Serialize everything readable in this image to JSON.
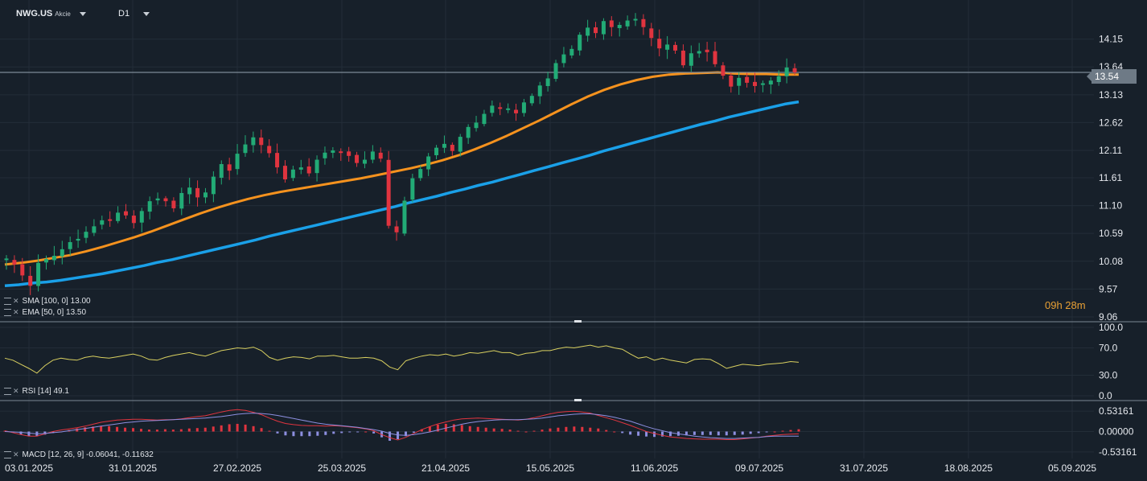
{
  "header": {
    "symbol": "NWG.US",
    "instrument_type": "Akcie",
    "timeframe": "D1"
  },
  "price_tag": "13.54",
  "timer": "09h 28m",
  "legends": {
    "sma": "SMA [100, 0] 13.00",
    "ema": "EMA [50, 0] 13.50",
    "rsi": "RSI [14] 49.1",
    "macd": "MACD [12, 26, 9] -0.06041, -0.11632"
  },
  "colors": {
    "background": "#17202a",
    "grid": "#232d38",
    "up_candle": "#22ab76",
    "down_candle": "#e0343f",
    "ema": "#f5921e",
    "sma": "#1aa0e8",
    "rsi": "#d9d060",
    "macd_line": "#e0343f",
    "signal_line": "#8d8fe0",
    "hist_pos": "#e0343f",
    "hist_neg": "#8d8fe0",
    "price_line": "#7d8a96"
  },
  "chart_data": [
    {
      "type": "candlestick",
      "yticks": [
        "14.15",
        "13.64",
        "13.13",
        "12.62",
        "12.11",
        "11.61",
        "11.10",
        "10.59",
        "10.08",
        "9.57",
        "9.06"
      ],
      "ylim": [
        9.06,
        14.66
      ],
      "x_date_labels": [
        "03.01.2025",
        "31.01.2025",
        "27.02.2025",
        "25.03.2025",
        "21.04.2025",
        "15.05.2025",
        "11.06.2025",
        "09.07.2025",
        "31.07.2025",
        "18.08.2025",
        "05.09.2025"
      ],
      "last_price": 13.54,
      "close": [
        10.13,
        10.02,
        9.82,
        9.63,
        10.05,
        10.12,
        10.18,
        10.3,
        10.43,
        10.49,
        10.62,
        10.72,
        10.83,
        10.82,
        10.97,
        10.92,
        10.78,
        11.0,
        11.18,
        11.23,
        11.18,
        11.05,
        11.33,
        11.43,
        11.25,
        11.34,
        11.63,
        11.86,
        11.74,
        12.05,
        12.22,
        12.35,
        12.21,
        12.06,
        11.8,
        11.58,
        11.76,
        11.8,
        11.69,
        11.94,
        12.07,
        12.11,
        12.08,
        12.01,
        11.88,
        11.94,
        12.09,
        11.96,
        10.73,
        10.61,
        11.19,
        11.6,
        11.77,
        12.0,
        12.16,
        12.23,
        12.1,
        12.36,
        12.54,
        12.62,
        12.78,
        12.93,
        12.88,
        12.88,
        12.79,
        12.99,
        13.11,
        13.3,
        13.43,
        13.71,
        13.87,
        13.97,
        14.23,
        14.36,
        14.26,
        14.48,
        14.37,
        14.41,
        14.49,
        14.52,
        14.37,
        14.17,
        13.98,
        14.05,
        13.94,
        13.67,
        13.89,
        13.93,
        13.91,
        13.69,
        13.48,
        13.28,
        13.44,
        13.35,
        13.29,
        13.34,
        13.39,
        13.47,
        13.63,
        13.54
      ],
      "sma": [
        9.63,
        9.65,
        9.68,
        9.7,
        9.73,
        9.77,
        9.81,
        9.85,
        9.9,
        9.95,
        10.0,
        10.06,
        10.11,
        10.17,
        10.23,
        10.29,
        10.35,
        10.41,
        10.47,
        10.54,
        10.6,
        10.66,
        10.72,
        10.78,
        10.84,
        10.9,
        10.96,
        11.02,
        11.08,
        11.15,
        11.21,
        11.27,
        11.34,
        11.4,
        11.47,
        11.53,
        11.6,
        11.67,
        11.74,
        11.81,
        11.88,
        11.95,
        12.02,
        12.1,
        12.17,
        12.24,
        12.31,
        12.38,
        12.45,
        12.52,
        12.59,
        12.65,
        12.72,
        12.78,
        12.84,
        12.9,
        12.96,
        13.0
      ],
      "ema": [
        10.02,
        10.05,
        10.09,
        10.14,
        10.19,
        10.26,
        10.34,
        10.43,
        10.52,
        10.62,
        10.73,
        10.84,
        10.95,
        11.05,
        11.14,
        11.22,
        11.29,
        11.35,
        11.4,
        11.45,
        11.5,
        11.55,
        11.6,
        11.66,
        11.72,
        11.78,
        11.85,
        11.93,
        12.02,
        12.13,
        12.25,
        12.38,
        12.52,
        12.66,
        12.81,
        12.96,
        13.1,
        13.22,
        13.32,
        13.4,
        13.46,
        13.5,
        13.52,
        13.53,
        13.54,
        13.52,
        13.51,
        13.51,
        13.5,
        13.5
      ]
    },
    {
      "type": "line",
      "name": "RSI [14]",
      "yticks": [
        "100.0",
        "70.0",
        "30.0",
        "0.0"
      ],
      "ylim": [
        0,
        100
      ],
      "values": [
        55,
        52,
        46,
        40,
        33,
        44,
        52,
        55,
        53,
        52,
        56,
        58,
        56,
        55,
        57,
        59,
        61,
        58,
        53,
        52,
        56,
        59,
        61,
        63,
        60,
        58,
        62,
        66,
        68,
        70,
        69,
        71,
        66,
        56,
        52,
        55,
        57,
        56,
        54,
        58,
        58,
        59,
        57,
        55,
        55,
        56,
        55,
        51,
        42,
        38,
        51,
        55,
        58,
        60,
        59,
        61,
        58,
        60,
        63,
        62,
        64,
        66,
        63,
        63,
        59,
        62,
        63,
        66,
        66,
        69,
        71,
        70,
        72,
        74,
        71,
        73,
        70,
        68,
        61,
        55,
        57,
        52,
        55,
        52,
        50,
        48,
        53,
        54,
        53,
        47,
        40,
        43,
        46,
        45,
        44,
        46,
        47,
        48,
        50,
        49
      ]
    },
    {
      "type": "bar+line",
      "name": "MACD [12, 26, 9]",
      "yticks": [
        "0.53161",
        "0.00000",
        "-0.53161"
      ],
      "ylim": [
        -0.66,
        0.66
      ],
      "histogram": [
        0.02,
        -0.03,
        -0.08,
        -0.12,
        -0.12,
        -0.08,
        -0.04,
        0.0,
        0.04,
        0.08,
        0.11,
        0.13,
        0.14,
        0.14,
        0.12,
        0.1,
        0.09,
        0.07,
        0.05,
        0.05,
        0.06,
        0.05,
        0.06,
        0.08,
        0.09,
        0.1,
        0.13,
        0.16,
        0.19,
        0.2,
        0.18,
        0.14,
        0.09,
        0.02,
        -0.05,
        -0.1,
        -0.12,
        -0.12,
        -0.12,
        -0.11,
        -0.09,
        -0.06,
        -0.04,
        -0.02,
        -0.01,
        0.0,
        -0.05,
        -0.15,
        -0.24,
        -0.2,
        -0.12,
        -0.03,
        0.06,
        0.13,
        0.18,
        0.2,
        0.19,
        0.17,
        0.14,
        0.12,
        0.1,
        0.08,
        0.07,
        0.05,
        0.02,
        0.0,
        0.02,
        0.05,
        0.08,
        0.1,
        0.12,
        0.13,
        0.12,
        0.1,
        0.08,
        0.04,
        0.0,
        -0.04,
        -0.08,
        -0.11,
        -0.13,
        -0.14,
        -0.13,
        -0.12,
        -0.11,
        -0.1,
        -0.09,
        -0.09,
        -0.09,
        -0.1,
        -0.1,
        -0.09,
        -0.08,
        -0.06,
        -0.04,
        -0.02,
        0.0,
        0.02,
        0.04,
        0.06
      ],
      "macd": [
        0.02,
        -0.03,
        -0.08,
        -0.12,
        -0.12,
        -0.06,
        0.0,
        0.04,
        0.07,
        0.1,
        0.14,
        0.19,
        0.24,
        0.27,
        0.3,
        0.31,
        0.32,
        0.32,
        0.31,
        0.3,
        0.31,
        0.31,
        0.33,
        0.36,
        0.39,
        0.41,
        0.46,
        0.51,
        0.55,
        0.57,
        0.55,
        0.5,
        0.44,
        0.35,
        0.27,
        0.21,
        0.18,
        0.16,
        0.15,
        0.15,
        0.14,
        0.15,
        0.14,
        0.12,
        0.1,
        0.07,
        0.02,
        -0.08,
        -0.16,
        -0.22,
        -0.15,
        -0.05,
        0.05,
        0.13,
        0.2,
        0.25,
        0.3,
        0.33,
        0.34,
        0.35,
        0.34,
        0.33,
        0.32,
        0.31,
        0.3,
        0.32,
        0.36,
        0.41,
        0.46,
        0.5,
        0.52,
        0.53,
        0.51,
        0.48,
        0.42,
        0.36,
        0.3,
        0.23,
        0.16,
        0.08,
        0.0,
        -0.05,
        -0.1,
        -0.14,
        -0.16,
        -0.18,
        -0.19,
        -0.2,
        -0.2,
        -0.2,
        -0.21,
        -0.21,
        -0.19,
        -0.17,
        -0.15,
        -0.12,
        -0.1,
        -0.08,
        -0.07,
        -0.06
      ],
      "signal": [
        0.0,
        -0.01,
        -0.02,
        -0.04,
        -0.06,
        -0.05,
        -0.03,
        -0.01,
        0.02,
        0.05,
        0.08,
        0.11,
        0.14,
        0.17,
        0.2,
        0.23,
        0.25,
        0.27,
        0.28,
        0.29,
        0.3,
        0.31,
        0.32,
        0.33,
        0.34,
        0.35,
        0.37,
        0.39,
        0.42,
        0.45,
        0.47,
        0.48,
        0.47,
        0.45,
        0.42,
        0.38,
        0.34,
        0.3,
        0.26,
        0.22,
        0.19,
        0.17,
        0.15,
        0.13,
        0.11,
        0.08,
        0.05,
        0.01,
        -0.05,
        -0.09,
        -0.1,
        -0.08,
        -0.05,
        -0.01,
        0.04,
        0.09,
        0.14,
        0.19,
        0.23,
        0.26,
        0.28,
        0.3,
        0.31,
        0.31,
        0.31,
        0.32,
        0.33,
        0.35,
        0.38,
        0.41,
        0.43,
        0.45,
        0.46,
        0.46,
        0.44,
        0.41,
        0.37,
        0.32,
        0.27,
        0.2,
        0.13,
        0.07,
        0.02,
        -0.03,
        -0.06,
        -0.09,
        -0.12,
        -0.14,
        -0.16,
        -0.17,
        -0.18,
        -0.18,
        -0.17,
        -0.16,
        -0.15,
        -0.13,
        -0.12,
        -0.12,
        -0.12,
        -0.12
      ]
    }
  ]
}
